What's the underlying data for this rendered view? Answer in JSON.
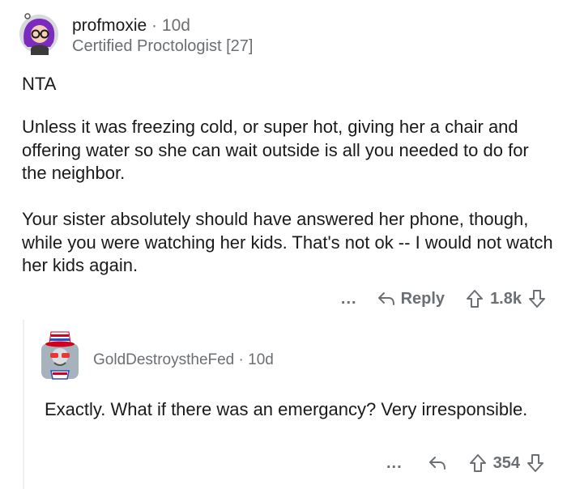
{
  "comments": [
    {
      "username": "profmoxie",
      "separator": "·",
      "age": "10d",
      "flair": "Certified Proctologist [27]",
      "body": [
        "NTA",
        "Unless it was freezing cold, or super hot, giving her a chair and offering water so she can wait outside is all you needed to do for the neighbor.",
        "Your sister absolutely should have answered her phone, though, while you were watching her kids. That's not ok -- I would not watch her kids again."
      ],
      "actions": {
        "more": "...",
        "reply": "Reply",
        "votes": "1.8k"
      }
    },
    {
      "username": "GoldDestroystheFed",
      "separator": "·",
      "age": "10d",
      "body": [
        "Exactly. What if there was an emergancy? Very irresponsible."
      ],
      "actions": {
        "more": "...",
        "votes": "354"
      }
    }
  ],
  "icons": {
    "avatar1": "purple-hair-avatar-icon",
    "avatar2": "uncle-sam-avatar-icon",
    "reply": "reply-arrow-icon",
    "upvote": "upvote-arrow-icon",
    "downvote": "downvote-arrow-icon"
  },
  "colors": {
    "text": "#1a1a1b",
    "meta": "#6b6f73",
    "thread": "#edeff1"
  }
}
